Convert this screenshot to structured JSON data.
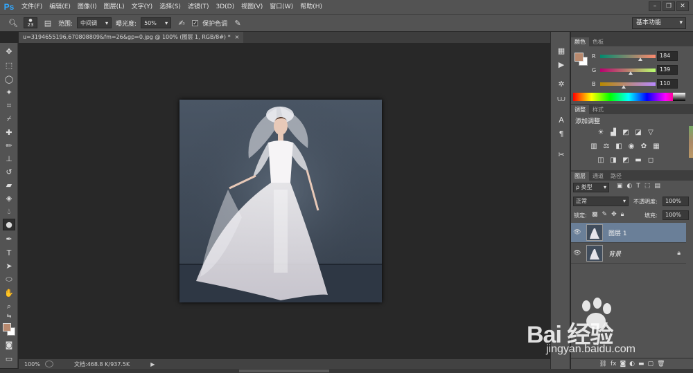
{
  "app": {
    "logo": "Ps"
  },
  "menu": [
    "文件(F)",
    "编辑(E)",
    "图像(I)",
    "图层(L)",
    "文字(Y)",
    "选择(S)",
    "滤镜(T)",
    "3D(D)",
    "视图(V)",
    "窗口(W)",
    "帮助(H)"
  ],
  "options": {
    "brush_size": "23",
    "range_label": "范围:",
    "range_value": "中间调",
    "exposure_label": "曝光度:",
    "exposure_value": "50%",
    "protect_tones_label": "保护色调",
    "protect_tones_checked": true,
    "workspace": "基本功能"
  },
  "document": {
    "tab_title": "u=3194655196,670808809&fm=26&gp=0.jpg @ 100% (图层 1, RGB/8#) *",
    "close_glyph": "×"
  },
  "status": {
    "zoom": "100%",
    "doc_info": "文档:468.8 K/937.5K"
  },
  "color_panel": {
    "tabs": [
      "颜色",
      "色板"
    ],
    "foreground_hex": "#b8896e",
    "background_hex": "#ffffff",
    "channels": [
      {
        "label": "R",
        "value": "184",
        "fraction": 0.72
      },
      {
        "label": "G",
        "value": "139",
        "fraction": 0.545
      },
      {
        "label": "B",
        "value": "110",
        "fraction": 0.43
      }
    ]
  },
  "adjustments_panel": {
    "tabs": [
      "调整",
      "样式"
    ],
    "heading": "添加调整",
    "row1": [
      "brightness-icon",
      "levels-icon",
      "curves-icon",
      "exposure-icon",
      "vibrance-icon"
    ],
    "row2": [
      "hue-sat-icon",
      "color-balance-icon",
      "bw-icon",
      "photo-filter-icon",
      "channel-mixer-icon",
      "color-lookup-icon"
    ],
    "row3": [
      "invert-icon",
      "posterize-icon",
      "threshold-icon",
      "gradient-map-icon",
      "selective-color-icon"
    ]
  },
  "layers_panel": {
    "tabs": [
      "图层",
      "通道",
      "路径"
    ],
    "filter_kind": "ρ 类型",
    "blend_mode": "正常",
    "opacity_label": "不透明度:",
    "opacity_value": "100%",
    "lock_label": "锁定:",
    "fill_label": "填充:",
    "fill_value": "100%",
    "layers": [
      {
        "name": "图层 1",
        "selected": true,
        "locked": false
      },
      {
        "name": "背景",
        "selected": false,
        "locked": true
      }
    ],
    "footer_icons": [
      "link-icon",
      "fx-icon",
      "mask-icon",
      "adjustment-icon",
      "folder-icon",
      "new-layer-icon",
      "trash-icon"
    ]
  },
  "watermark": {
    "brand": "Bai 经验",
    "url": "jingyan.baidu.com"
  }
}
